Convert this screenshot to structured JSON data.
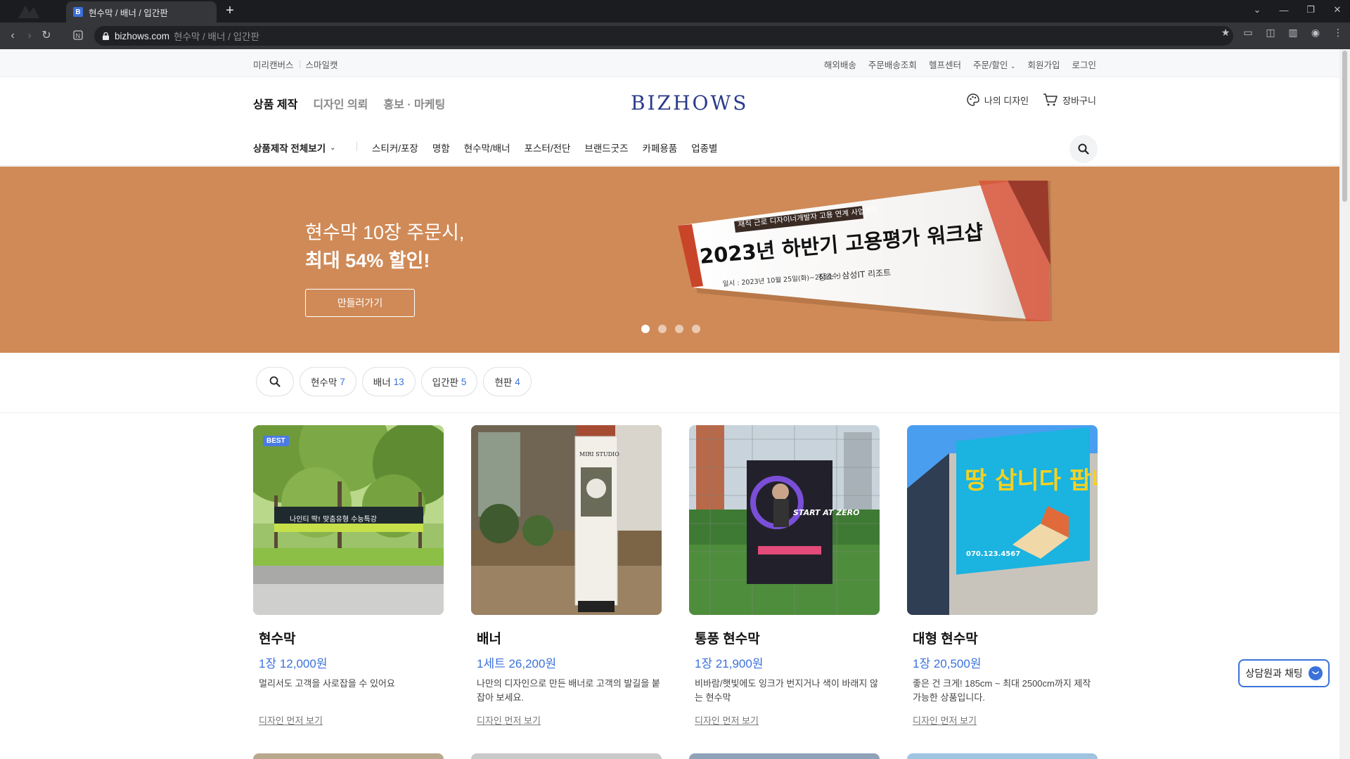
{
  "browser": {
    "tab_title": "현수막 / 배너 / 입간판",
    "favicon_letter": "B",
    "new_tab": "+",
    "url_host": "bizhows.com",
    "url_path": "현수막 / 배너 / 입간판"
  },
  "util_bar": {
    "left": [
      "미리캔버스",
      "스마일캣"
    ],
    "right": [
      "해외배송",
      "주문배송조회",
      "헬프센터",
      "주문/할인",
      "회원가입",
      "로그인"
    ]
  },
  "header": {
    "gnb": [
      "상품 제작",
      "디자인 의뢰",
      "홍보 · 마케팅"
    ],
    "logo": "BIZHOWS",
    "my_design": "나의 디자인",
    "cart": "장바구니"
  },
  "category_nav": {
    "all_label": "상품제작 전체보기",
    "items": [
      "스티커/포장",
      "명함",
      "현수막/배너",
      "포스터/전단",
      "브랜드굿즈",
      "카페용품",
      "업종별"
    ]
  },
  "hero": {
    "line1": "현수막 10장 주문시,",
    "line2": "최대 54% 할인!",
    "button": "만들러가기",
    "banner_subtitle": "재직 근로 디자이너개발자 고용 연계 사업관리",
    "banner_title": "2023년 하반기 고용평가 워크샵",
    "banner_date": "일시 : 2023년 10월 25일(화)~26일(수)",
    "banner_place": "장소 : 삼성IT 리조트",
    "active_slide": 1,
    "slide_count": 4,
    "bg_color": "#d08a57"
  },
  "filters": [
    {
      "label": "현수막",
      "count": "7"
    },
    {
      "label": "배너",
      "count": "13"
    },
    {
      "label": "입간판",
      "count": "5"
    },
    {
      "label": "현판",
      "count": "4"
    }
  ],
  "products": [
    {
      "title": "현수막",
      "price": "1장 12,000원",
      "desc": "멀리서도 고객을 사로잡을 수 있어요",
      "link": "디자인 먼저 보기",
      "badge": "BEST",
      "thumb_banner": "나인티 딱! 맞춤유형 수능특강"
    },
    {
      "title": "배너",
      "price": "1세트 26,200원",
      "desc": "나만의 디자인으로 만든 배너로 고객의 발길을 붙잡아 보세요.",
      "link": "디자인 먼저 보기",
      "thumb_banner": "MIRI STUDIO"
    },
    {
      "title": "통풍 현수막",
      "price": "1장 21,900원",
      "desc": "비바람/햇빛에도 잉크가 번지거나 색이 바래지 않는 현수막",
      "link": "디자인 먼저 보기",
      "thumb_banner": "START AT ZERO"
    },
    {
      "title": "대형 현수막",
      "price": "1장 20,500원",
      "desc": "좋은 건 크게! 185cm ~ 최대 2500cm까지 제작 가능한 상품입니다.",
      "link": "디자인 먼저 보기",
      "thumb_banner": "땅 삽니다 팝니다",
      "thumb_phone": "070.123.4567"
    }
  ],
  "chat": {
    "label": "상담원과 채팅"
  },
  "colors": {
    "accent": "#3b72d9",
    "logo": "#2a3a8a"
  }
}
